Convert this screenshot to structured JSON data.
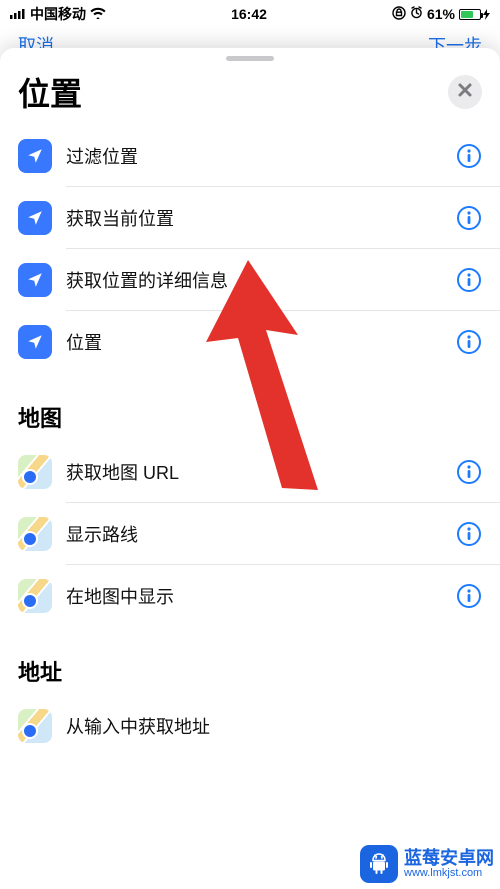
{
  "status_bar": {
    "carrier": "中国移动",
    "time": "16:42",
    "battery_pct": "61%"
  },
  "underlying_nav": {
    "left": "取消",
    "right": "下一步"
  },
  "sheet": {
    "title": "位置"
  },
  "sections": {
    "location": {
      "header": "",
      "items": {
        "filter": {
          "label": "过滤位置"
        },
        "current": {
          "label": "获取当前位置"
        },
        "details": {
          "label": "获取位置的详细信息"
        },
        "location": {
          "label": "位置"
        }
      }
    },
    "maps": {
      "header": "地图",
      "items": {
        "url": {
          "label": "获取地图 URL"
        },
        "route": {
          "label": "显示路线"
        },
        "show": {
          "label": "在地图中显示"
        }
      }
    },
    "address": {
      "header": "地址",
      "items": {
        "frominput": {
          "label": "从输入中获取地址"
        }
      }
    }
  },
  "watermark": {
    "name": "蓝莓安卓网",
    "url": "www.lmkjst.com"
  },
  "colors": {
    "accent_blue": "#3878ff",
    "info_blue": "#1d7bff",
    "arrow_red": "#e2322b"
  }
}
